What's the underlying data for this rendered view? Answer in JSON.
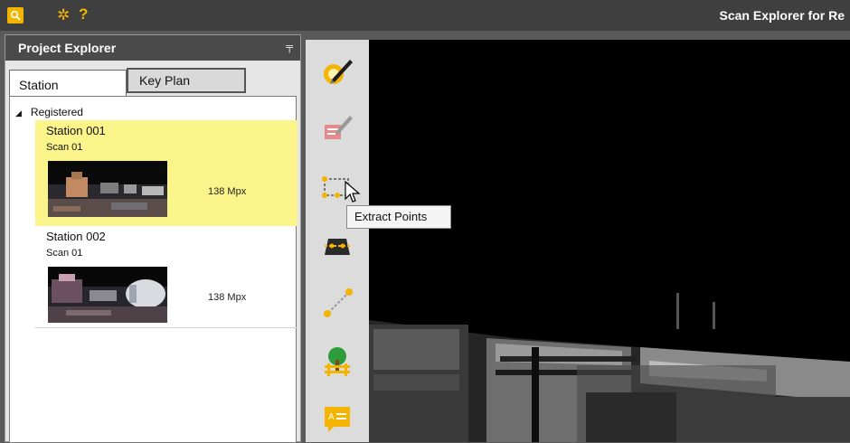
{
  "app": {
    "title": "Scan Explorer for Re"
  },
  "icons": {
    "logo": "search-logo-icon",
    "settings": "gear-icon",
    "help": "help-icon",
    "pin": "pin-icon"
  },
  "help_glyph": "?",
  "panel": {
    "title": "Project Explorer",
    "tabs": [
      {
        "label": "Station",
        "active": true
      },
      {
        "label": "Key Plan",
        "active": false
      }
    ],
    "tree": {
      "root": "Registered",
      "stations": [
        {
          "name": "Station 001",
          "scan": "Scan 01",
          "size": "138 Mpx",
          "selected": true
        },
        {
          "name": "Station 002",
          "scan": "Scan 01",
          "size": "138 Mpx",
          "selected": false
        }
      ]
    }
  },
  "toolbar": {
    "tools": [
      "edit-scan-icon",
      "markup-icon",
      "extract-points-icon",
      "slice-icon",
      "measure-icon",
      "tree-fence-icon",
      "annotation-icon"
    ]
  },
  "tooltip": "Extract Points",
  "colors": {
    "accent": "#f5b400",
    "selected_row": "#fbf48a",
    "titlebar": "#3f3f3f"
  }
}
